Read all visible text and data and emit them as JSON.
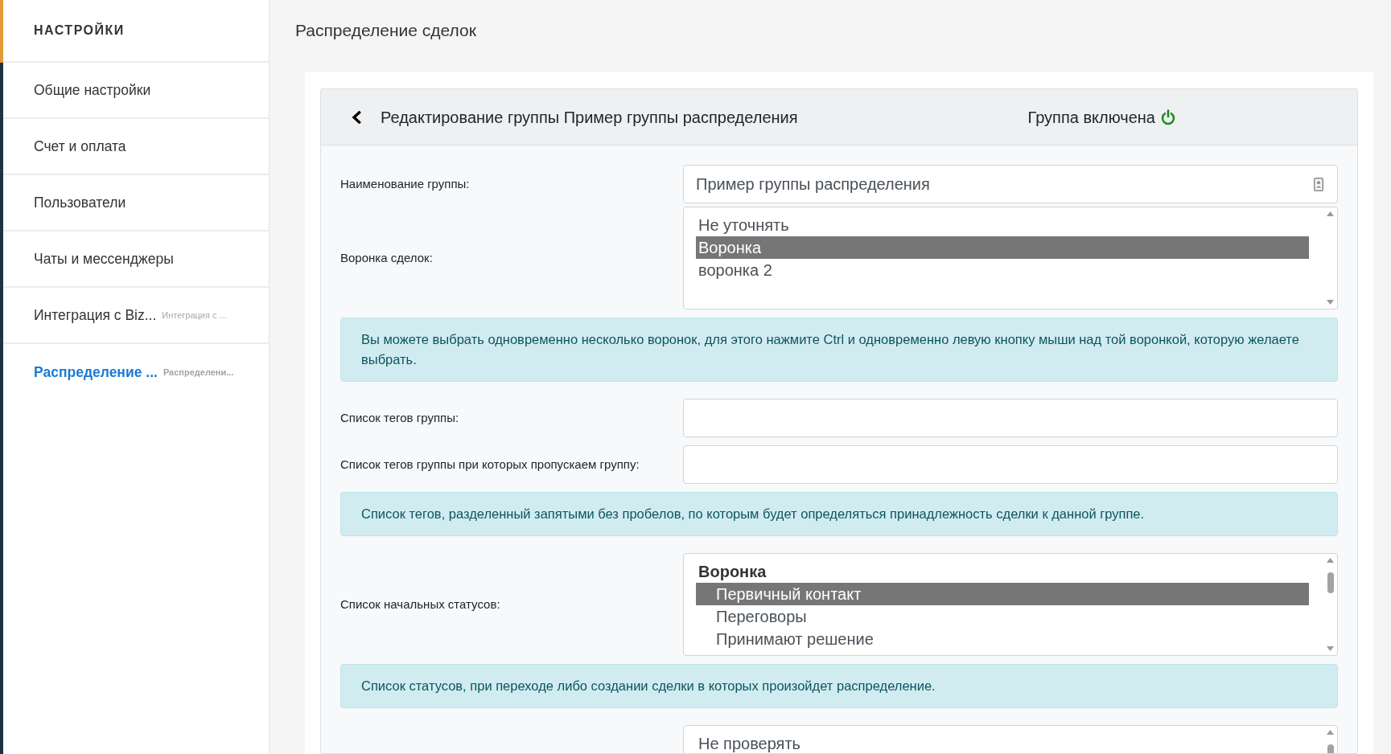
{
  "sidebar": {
    "title": "НАСТРОЙКИ",
    "items": [
      {
        "label": "Общие настройки",
        "selected": false
      },
      {
        "label": "Счет и оплата",
        "selected": false
      },
      {
        "label": "Пользователи",
        "selected": false
      },
      {
        "label": "Чаты и мессенджеры",
        "selected": false
      },
      {
        "label": "Интеграция с Biz...",
        "subtitle": "Интеграция с ...",
        "selected": false
      },
      {
        "label": "Распределение ...",
        "subtitle": "Распределени...",
        "selected": true
      }
    ]
  },
  "page_title": "Распределение сделок",
  "card": {
    "title": "Редактирование группы Пример группы распределения",
    "status": {
      "label": "Группа включена",
      "on": true
    }
  },
  "form": [
    {
      "kind": "text",
      "label": "Наименование группы:",
      "value": "Пример группы распределения"
    },
    {
      "kind": "listbox",
      "label": "Воронка сделок:",
      "scrollable": false,
      "options": [
        {
          "kind": "option",
          "label": "Не уточнять",
          "selected": false
        },
        {
          "kind": "option",
          "label": "Воронка",
          "selected": true
        },
        {
          "kind": "option",
          "label": "воронка 2",
          "selected": false
        }
      ]
    },
    {
      "kind": "alert",
      "text": "Вы можете выбрать одновременно несколько воронок, для этого нажмите Ctrl и одновременно левую кнопку мыши над той воронкой, которую желаете выбрать."
    },
    {
      "kind": "text",
      "label": "Список тегов группы:"
    },
    {
      "kind": "text",
      "label": "Список тегов группы при которых пропускаем группу:"
    },
    {
      "kind": "alert",
      "text": "Список тегов, разделенный запятыми без пробелов, по которым будет определяться принадлежность сделки к данной группе."
    },
    {
      "kind": "listbox",
      "label": "Список начальных статусов:",
      "scrollable": true,
      "options": [
        {
          "kind": "group",
          "label": "Воронка",
          "children": [
            {
              "label": "Первичный контакт",
              "selected": true
            },
            {
              "label": "Переговоры",
              "selected": false
            },
            {
              "label": "Принимают решение",
              "selected": false
            }
          ]
        }
      ]
    },
    {
      "kind": "alert",
      "text": "Список статусов, при переходе либо создании сделки в которых произойдет распределение."
    },
    {
      "kind": "listbox",
      "scrollable": true,
      "options": [
        {
          "kind": "option",
          "label": "Не проверять",
          "selected": false
        }
      ]
    }
  ]
}
